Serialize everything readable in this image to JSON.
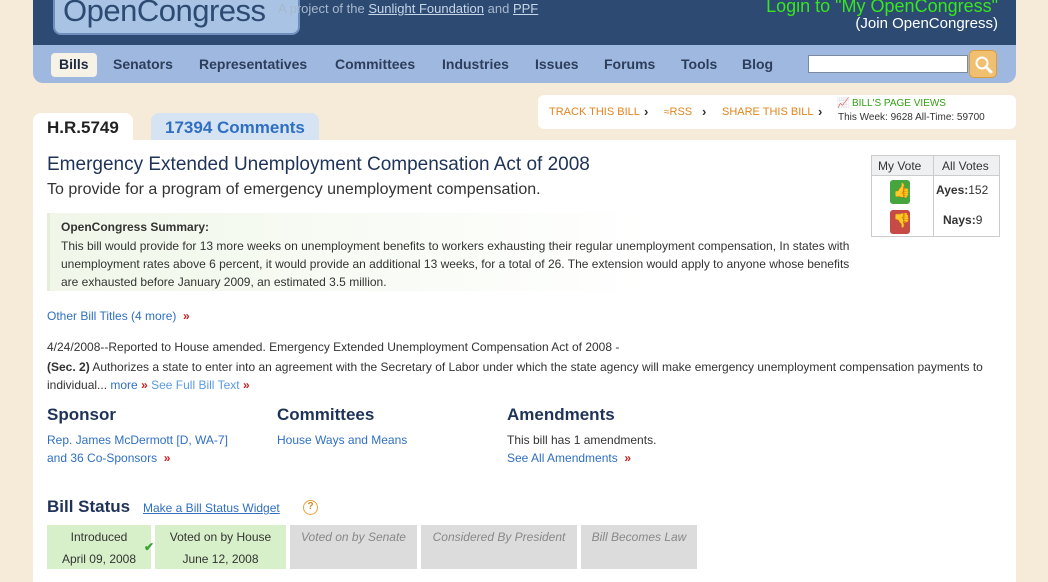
{
  "header": {
    "logo": "OpenCongress",
    "tagline_prefix": "A project of the",
    "tagline_link1": "Sunlight Foundation",
    "tagline_and": "and",
    "tagline_link2": "PPF",
    "login": "Login to \"My OpenCongress\"",
    "join": "(Join OpenCongress)"
  },
  "nav": {
    "items": [
      "Bills",
      "Senators",
      "Representatives",
      "Committees",
      "Industries",
      "Issues",
      "Forums",
      "Tools",
      "Blog"
    ],
    "active": "Bills",
    "search_value": ""
  },
  "tabs": {
    "bill": "H.R.5749",
    "comments": "17394 Comments"
  },
  "track": {
    "track_label": "TRACK THIS BILL",
    "rss_label": "RSS",
    "share_label": "SHARE THIS BILL",
    "page_views_title": "BILL'S PAGE VIEWS",
    "page_views_stats": "This Week: 9628   All-Time: 59700"
  },
  "bill": {
    "title": "Emergency Extended Unemployment Compensation Act of 2008",
    "subtitle": "To provide for a program of emergency unemployment compensation.",
    "summary_title": "OpenCongress Summary:",
    "summary_text": "This bill would provide for 13 more weeks on unemployment benefits to workers exhausting their regular unemployment compensation, In states with unemployment rates above 6 percent, it would provide an additional 13 weeks, for a total of 26. The extension would apply to anyone whose benefits are exhausted before January 2009, an estimated 3.5 million.",
    "other_titles": "Other Bill Titles (4 more)",
    "action_line": "4/24/2008--Reported to House amended. Emergency Extended Unemployment Compensation Act of 2008 -",
    "sec_label": "(Sec. 2)",
    "sec_text": " Authorizes a state to enter into an agreement with the Secretary of Labor under which the state agency will make emergency unemployment compensation payments to individual...",
    "more_label": "more",
    "full_text_label": "See Full Bill Text"
  },
  "votes": {
    "my_vote_label": "My Vote",
    "all_votes_label": "All Votes",
    "ayes_label": "Ayes:",
    "ayes_value": "152",
    "nays_label": "Nays:",
    "nays_value": "9"
  },
  "sponsor": {
    "title": "Sponsor",
    "name": "Rep. James McDermott [D, WA-7]",
    "cosponsors": "and 36 Co-Sponsors"
  },
  "committees": {
    "title": "Committees",
    "name": "House Ways and Means"
  },
  "amendments": {
    "title": "Amendments",
    "text": "This bill has 1 amendments.",
    "link": "See All Amendments"
  },
  "bill_status": {
    "title": "Bill Status",
    "widget_link": "Make a Bill Status Widget",
    "help": "?",
    "stages": [
      {
        "label": "Introduced",
        "date": "April 09, 2008",
        "done": true
      },
      {
        "label": "Voted on by House",
        "date": "June 12, 2008",
        "done": true
      },
      {
        "label": "Voted on by Senate",
        "date": "",
        "done": false
      },
      {
        "label": "Considered By President",
        "date": "",
        "done": false
      },
      {
        "label": "Bill Becomes Law",
        "date": "",
        "done": false
      }
    ]
  },
  "colors": {
    "header_bg": "#2d4a72",
    "nav_bg": "#9fb8df",
    "login_green": "#37e61e",
    "link_blue": "#2f6fc1",
    "track_orange": "#e0851c"
  }
}
